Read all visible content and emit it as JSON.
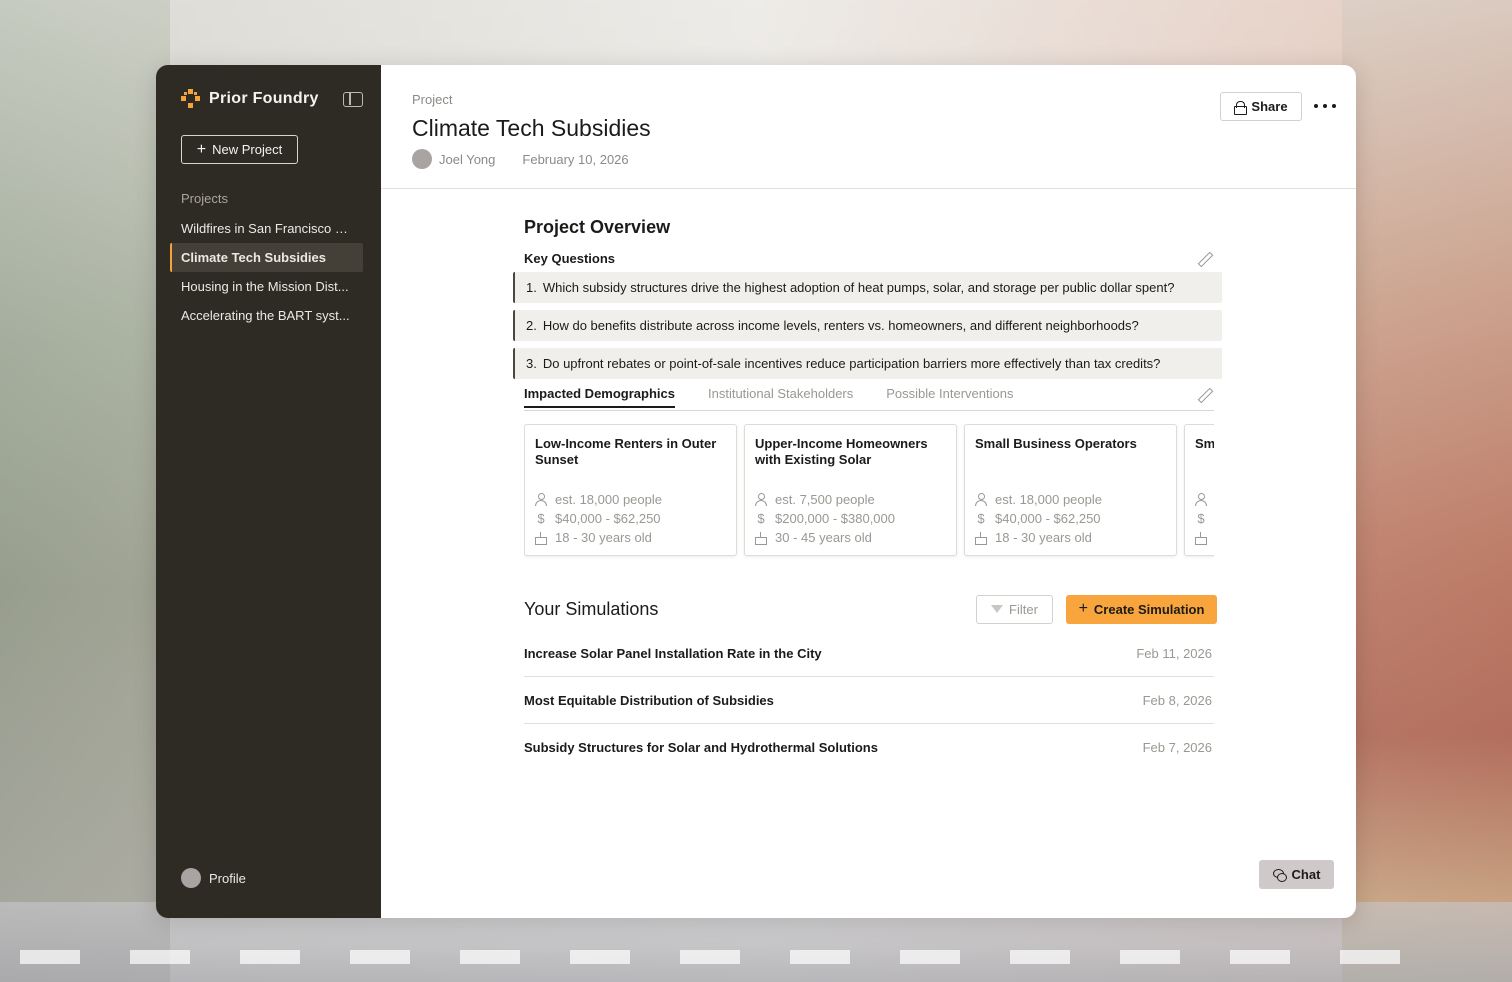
{
  "sidebar": {
    "brand": "Prior Foundry",
    "new_project_label": "New Project",
    "projects_label": "Projects",
    "projects": [
      {
        "label": "Wildfires in San Francisco C..."
      },
      {
        "label": "Climate Tech Subsidies",
        "active": true
      },
      {
        "label": "Housing in the Mission Dist..."
      },
      {
        "label": "Accelerating the BART syst..."
      }
    ],
    "profile_label": "Profile"
  },
  "header": {
    "breadcrumb": "Project",
    "title": "Climate Tech Subsidies",
    "author": "Joel Yong",
    "date": "February 10, 2026",
    "share_label": "Share"
  },
  "overview": {
    "title": "Project Overview",
    "key_questions_label": "Key Questions",
    "questions": [
      {
        "num": "1.",
        "text": "Which subsidy structures drive the highest adoption of heat pumps, solar, and storage per public dollar spent?"
      },
      {
        "num": "2.",
        "text": "How do benefits distribute across income levels, renters vs. homeowners, and different neighborhoods?"
      },
      {
        "num": "3.",
        "text": "Do upfront rebates or point-of-sale incentives reduce participation barriers more effectively than tax credits?"
      }
    ],
    "tabs": [
      {
        "label": "Impacted Demographics",
        "active": true
      },
      {
        "label": "Institutional Stakeholders"
      },
      {
        "label": "Possible Interventions"
      }
    ],
    "cards": [
      {
        "title": "Low-Income Renters in Outer Sunset",
        "people": "est. 18,000 people",
        "income": "$40,000 - $62,250",
        "age": "18 - 30 years old"
      },
      {
        "title": "Upper-Income Homeowners with Existing Solar",
        "people": "est. 7,500 people",
        "income": "$200,000 - $380,000",
        "age": "30 - 45 years old"
      },
      {
        "title": "Small Business Operators",
        "people": "est. 18,000 people",
        "income": "$40,000 - $62,250",
        "age": "18 - 30 years old"
      },
      {
        "title": "Sm",
        "people": "",
        "income": "",
        "age": ""
      }
    ]
  },
  "simulations": {
    "title": "Your Simulations",
    "filter_label": "Filter",
    "create_label": "Create Simulation",
    "items": [
      {
        "name": "Increase Solar Panel Installation Rate in the City",
        "date": "Feb 11, 2026"
      },
      {
        "name": "Most Equitable Distribution of Subsidies",
        "date": "Feb 8, 2026"
      },
      {
        "name": "Subsidy Structures for Solar and Hydrothermal Solutions",
        "date": "Feb 7, 2026"
      }
    ]
  },
  "chat_label": "Chat",
  "colors": {
    "accent": "#f7a53c",
    "sidebar_bg": "#2e2b24",
    "question_bg": "#f1efeb"
  }
}
